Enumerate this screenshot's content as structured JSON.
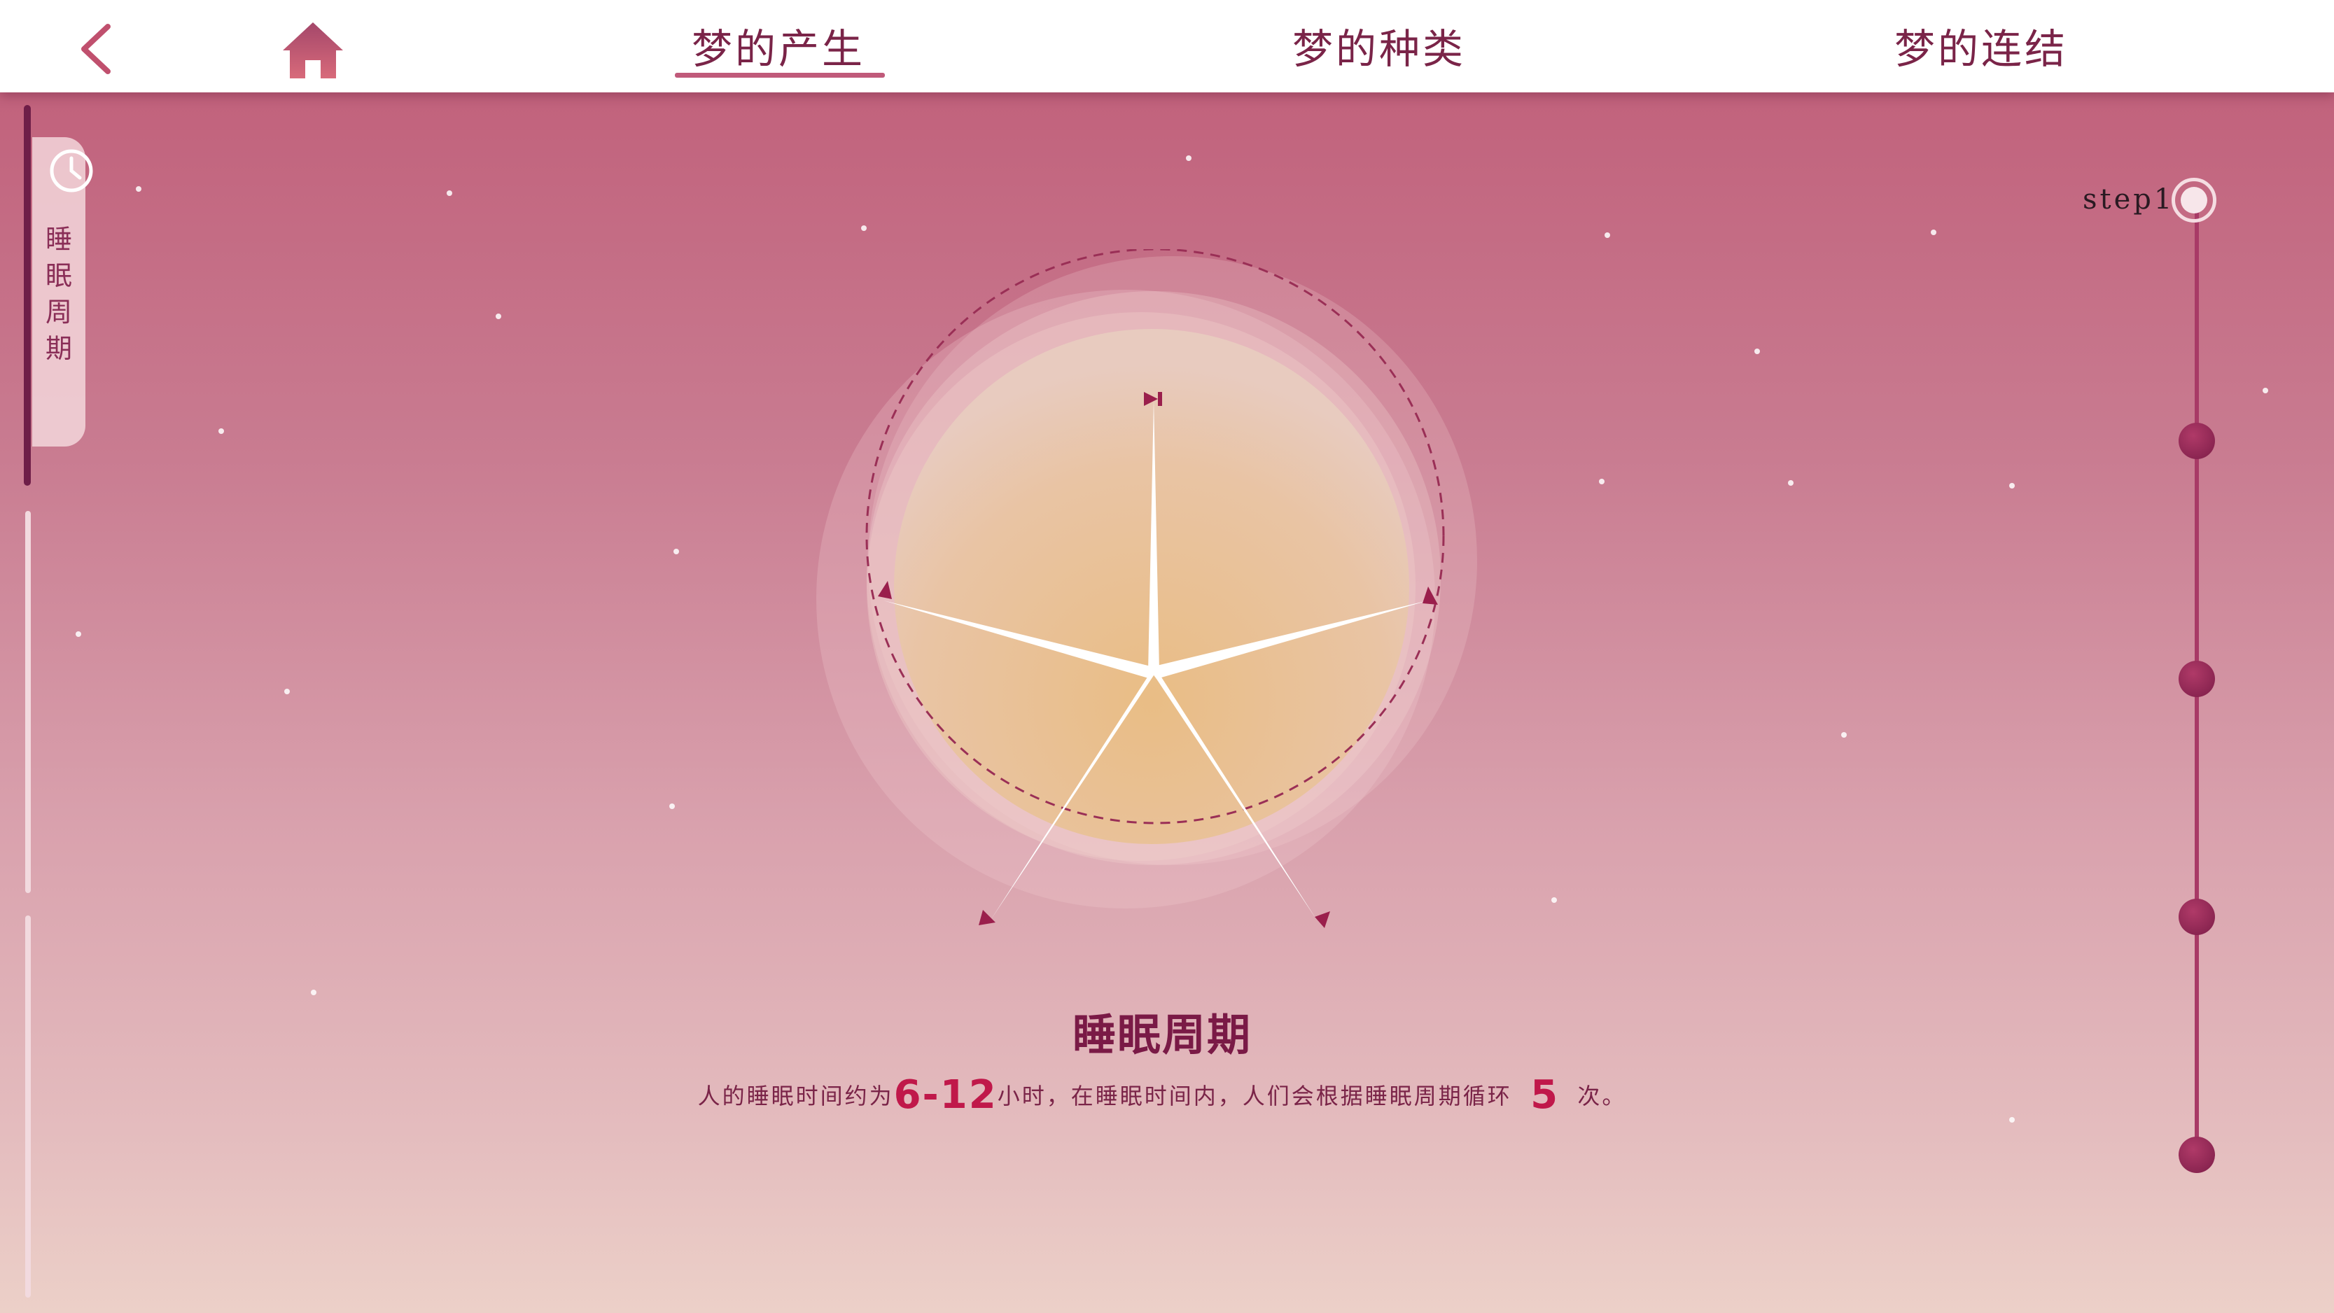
{
  "header": {
    "tabs": [
      {
        "label": "梦的产生",
        "active": true
      },
      {
        "label": "梦的种类",
        "active": false
      },
      {
        "label": "梦的连结",
        "active": false
      }
    ],
    "icons": {
      "back": "chevron-left-icon",
      "home": "home-icon"
    }
  },
  "sidebar": {
    "items": [
      {
        "label": "睡眠周期",
        "icon": "clock-icon",
        "active": true
      }
    ]
  },
  "main": {
    "title": "睡眠周期",
    "desc_part1": "人的睡眠时间约为",
    "hours": "6-12",
    "desc_part2": "小时，在睡眠时间内，人们会根据睡眠周期循环",
    "cycles": "5",
    "desc_part3": "次。"
  },
  "steps": {
    "current_label": "step1",
    "count": 5,
    "current": 1
  },
  "colors": {
    "accent": "#7a2448",
    "highlight": "#c0184a",
    "step_dot": "#9a2a58",
    "bg_top": "#c1627c",
    "bg_bottom": "#ecd0c8"
  }
}
